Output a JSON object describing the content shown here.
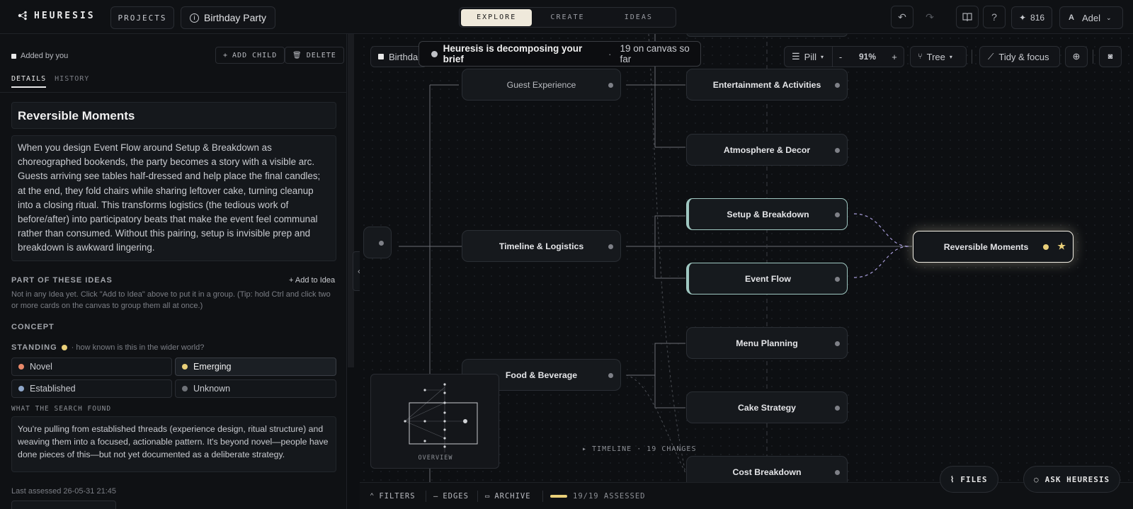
{
  "app": {
    "name": "HEURESIS"
  },
  "topbar": {
    "projects_label": "PROJECTS",
    "project_name": "Birthday Party",
    "modes": [
      "EXPLORE",
      "CREATE",
      "IDEAS"
    ],
    "active_mode": "EXPLORE",
    "credits": "816",
    "user_initial": "A",
    "user_name": "Adel"
  },
  "panel": {
    "added_by": "Added by you",
    "add_child_label": "ADD CHILD",
    "delete_label": "DELETE",
    "tabs": [
      "DETAILS",
      "HISTORY"
    ],
    "title": "Reversible Moments",
    "description": "When you design Event Flow around Setup & Breakdown as choreographed bookends, the party becomes a story with a visible arc. Guests arriving see tables half-dressed and help place the final candles; at the end, they fold chairs while sharing leftover cake, turning cleanup into a closing ritual. This transforms logistics (the tedious work of before/after) into participatory beats that make the event feel communal rather than consumed. Without this pairing, setup is invisible prep and breakdown is awkward lingering.",
    "ideas_heading": "PART OF THESE IDEAS",
    "add_to_idea": "+ Add to Idea",
    "ideas_hint": "Not in any Idea yet. Click \"Add to Idea\" above to put it in a group. (Tip: hold Ctrl and click two or more cards on the canvas to group them all at once.)",
    "concept_heading": "CONCEPT",
    "standing_heading": "STANDING",
    "standing_hint": "· how known is this in the wider world?",
    "standing_options": [
      {
        "label": "Novel",
        "color": "#e8896a"
      },
      {
        "label": "Emerging",
        "color": "#e9cf79"
      },
      {
        "label": "Established",
        "color": "#8ea6c9"
      },
      {
        "label": "Unknown",
        "color": "#6f7278"
      }
    ],
    "standing_selected": "Emerging",
    "search_heading": "WHAT THE SEARCH FOUND",
    "search_text": "You're pulling from established threads (experience design, ritual structure) and weaving them into a focused, actionable pattern. It's beyond novel—people have done pieces of this—but not yet documented as a deliberate strategy.",
    "last_assessed": "Last assessed 26-05-31 21:45"
  },
  "canvas": {
    "breadcrumb": "Birthda",
    "toast_title": "Heuresis is decomposing your brief",
    "toast_count": "19 on canvas so far",
    "view_label": "Pill",
    "zoom": "91%",
    "layout_label": "Tree",
    "tidy_label": "Tidy & focus",
    "nodes": {
      "guest": "Guest Experience",
      "timeline": "Timeline & Logistics",
      "food": "Food & Beverage",
      "entertainment": "Entertainment & Activities",
      "atmosphere": "Atmosphere & Decor",
      "setup": "Setup & Breakdown",
      "flow": "Event Flow",
      "menu": "Menu Planning",
      "cake": "Cake Strategy",
      "cost": "Cost Breakdown",
      "reversible": "Reversible Moments"
    },
    "overview_label": "OVERVIEW",
    "timeline_label": "▸ TIMELINE · 19 CHANGES"
  },
  "bottom": {
    "filters": "FILTERS",
    "edges": "EDGES",
    "archive": "ARCHIVE",
    "assessed": "19/19 ASSESSED",
    "assessed_fraction": 1.0,
    "files": "FILES",
    "ask": "ASK HEURESIS"
  }
}
